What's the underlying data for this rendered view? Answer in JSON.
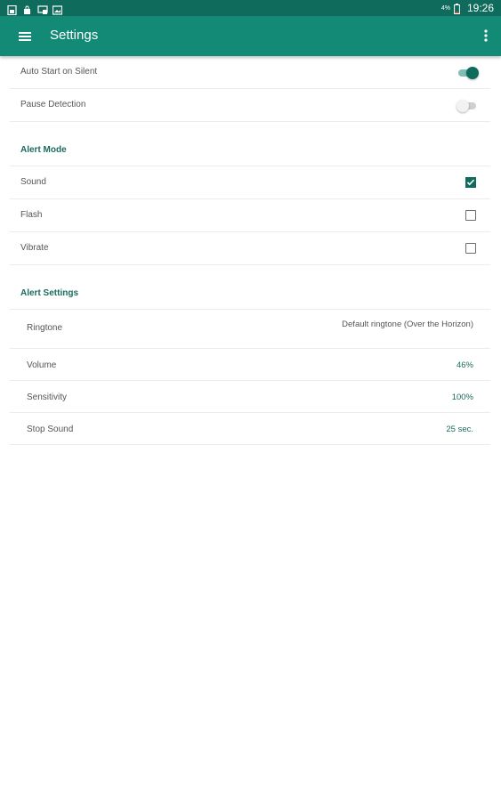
{
  "status_bar": {
    "battery_percent": "4%",
    "time": "19:26",
    "icons": [
      "sim-card-icon",
      "bag-icon",
      "cast-icon",
      "image-icon",
      "battery-icon"
    ]
  },
  "app_bar": {
    "title": "Settings",
    "menu_icon": "hamburger-menu-icon",
    "overflow_icon": "more-vert-icon"
  },
  "toggles": [
    {
      "label": "Auto Start on Silent",
      "on": true
    },
    {
      "label": "Pause Detection",
      "on": false
    }
  ],
  "alert_mode": {
    "title": "Alert Mode",
    "options": [
      {
        "label": "Sound",
        "checked": true
      },
      {
        "label": "Flash",
        "checked": false
      },
      {
        "label": "Vibrate",
        "checked": false
      }
    ]
  },
  "alert_settings": {
    "title": "Alert Settings",
    "items": [
      {
        "label": "Ringtone",
        "value": "Default ringtone (Over the Horizon)"
      },
      {
        "label": "Volume",
        "value": "46%"
      },
      {
        "label": "Sensitivity",
        "value": "100%"
      },
      {
        "label": "Stop Sound",
        "value": "25 sec."
      }
    ]
  },
  "colors": {
    "status_bar": "#0f6b5c",
    "app_bar": "#138a76",
    "accent": "#0f6b5c",
    "accent_text": "#1b6b5c"
  }
}
